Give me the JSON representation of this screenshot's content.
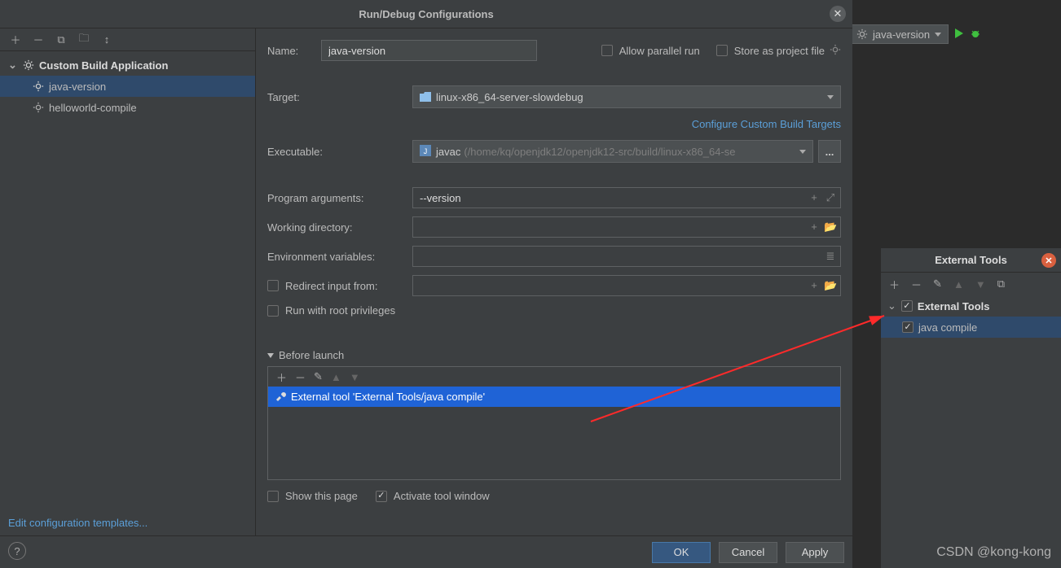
{
  "dialog": {
    "title": "Run/Debug Configurations",
    "close": "✕",
    "ok": "OK",
    "cancel": "Cancel",
    "apply": "Apply"
  },
  "sidebar": {
    "category": "Custom Build Application",
    "items": [
      "java-version",
      "helloworld-compile"
    ],
    "selected_index": 0,
    "edit_templates": "Edit configuration templates..."
  },
  "form": {
    "name": {
      "label": "Name:",
      "value": "java-version"
    },
    "allow_parallel": {
      "label": "Allow parallel run",
      "checked": false
    },
    "store_project": {
      "label": "Store as project file",
      "checked": false
    },
    "target": {
      "label": "Target:",
      "value": "linux-x86_64-server-slowdebug",
      "configure_link": "Configure Custom Build Targets"
    },
    "executable": {
      "label": "Executable:",
      "value": "javac",
      "suffix": "(/home/kq/openjdk12/openjdk12-src/build/linux-x86_64-se"
    },
    "program_args": {
      "label": "Program arguments:",
      "value": "--version"
    },
    "working_dir": {
      "label": "Working directory:",
      "value": ""
    },
    "env_vars": {
      "label": "Environment variables:",
      "value": ""
    },
    "redirect_input": {
      "label": "Redirect input from:",
      "checked": false
    },
    "root_priv": {
      "label": "Run with root privileges",
      "checked": false
    },
    "before_launch": {
      "title": "Before launch",
      "items": [
        "External tool 'External Tools/java compile'"
      ]
    },
    "show_this_page": {
      "label": "Show this page",
      "checked": false
    },
    "activate_tool_window": {
      "label": "Activate tool window",
      "checked": true
    }
  },
  "ide": {
    "combo": "java-version"
  },
  "ext": {
    "title": "External Tools",
    "root": "External Tools",
    "child": "java compile"
  },
  "watermark": "CSDN @kong-kong",
  "glyph": {
    "plus": "＋",
    "minus": "－",
    "copy": "⧉",
    "folder": "🗀",
    "sort": "↕",
    "pencil": "✎",
    "up": "▲",
    "down": "▼",
    "ellipsis": "..."
  }
}
